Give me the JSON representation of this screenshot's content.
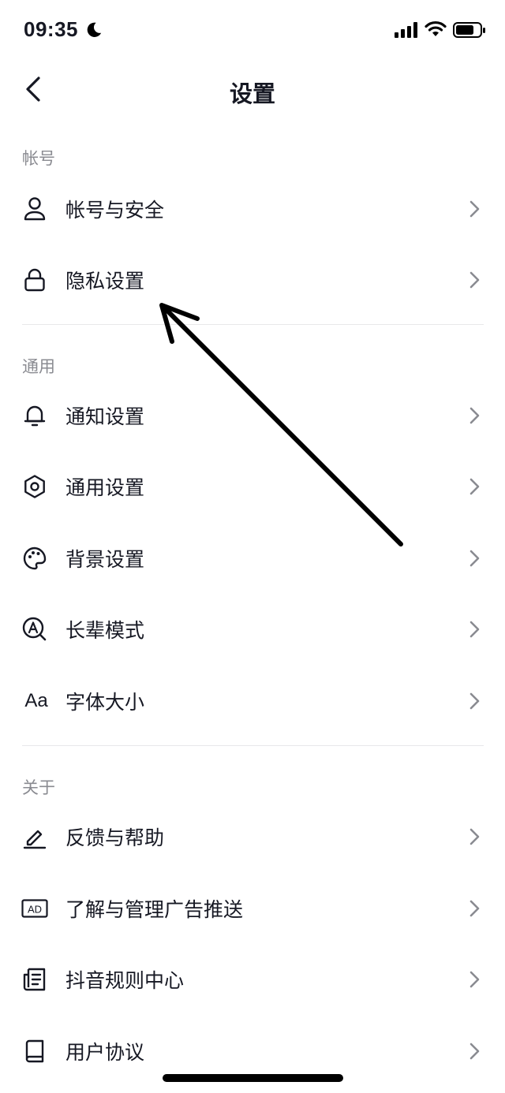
{
  "status_bar": {
    "time": "09:35"
  },
  "nav": {
    "title": "设置"
  },
  "sections": [
    {
      "header": "帐号",
      "items": [
        {
          "label": "帐号与安全",
          "icon": "user-icon"
        },
        {
          "label": "隐私设置",
          "icon": "lock-icon"
        }
      ]
    },
    {
      "header": "通用",
      "items": [
        {
          "label": "通知设置",
          "icon": "bell-icon"
        },
        {
          "label": "通用设置",
          "icon": "gear-icon"
        },
        {
          "label": "背景设置",
          "icon": "palette-icon"
        },
        {
          "label": "长辈模式",
          "icon": "elder-mode-icon"
        },
        {
          "label": "字体大小",
          "icon": "font-size-icon",
          "icon_text": "Aa"
        }
      ]
    },
    {
      "header": "关于",
      "items": [
        {
          "label": "反馈与帮助",
          "icon": "pencil-icon"
        },
        {
          "label": "了解与管理广告推送",
          "icon": "ad-icon",
          "icon_text": "AD"
        },
        {
          "label": "抖音规则中心",
          "icon": "document-icon"
        },
        {
          "label": "用户协议",
          "icon": "book-icon"
        }
      ]
    }
  ],
  "colors": {
    "text": "#161823",
    "secondary_text": "#8a8b91",
    "divider": "#e8e8ea",
    "chevron": "#8a8b91"
  }
}
